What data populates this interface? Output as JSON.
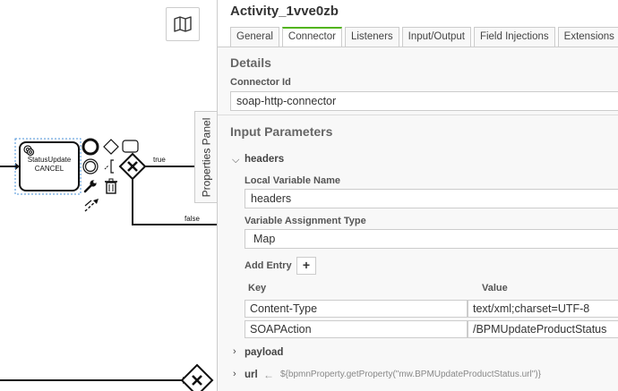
{
  "canvas": {
    "map_button_icon": "map-icon",
    "task_label_line1": "StatusUpdate",
    "task_label_line2": "CANCEL",
    "flow_label_true": "true",
    "flow_label_false": "false",
    "panel_toggle_label": "Properties Panel"
  },
  "panel": {
    "title": "Activity_1vve0zb",
    "tabs": [
      {
        "label": "General"
      },
      {
        "label": "Connector"
      },
      {
        "label": "Listeners"
      },
      {
        "label": "Input/Output"
      },
      {
        "label": "Field Injections"
      },
      {
        "label": "Extensions"
      }
    ],
    "active_tab": "Connector",
    "details": {
      "title": "Details",
      "connector_id_label": "Connector Id",
      "connector_id_value": "soap-http-connector"
    },
    "input_parameters": {
      "title": "Input Parameters",
      "headers": {
        "name": "headers",
        "local_variable_label": "Local Variable Name",
        "local_variable_value": "headers",
        "assignment_type_label": "Variable Assignment Type",
        "assignment_type_value": "Map",
        "add_entry_label": "Add Entry",
        "add_entry_button": "+",
        "columns": {
          "key": "Key",
          "value": "Value"
        },
        "entries": [
          {
            "key": "Content-Type",
            "value": "text/xml;charset=UTF-8"
          },
          {
            "key": "SOAPAction",
            "value": "/BPMUpdateProductStatus"
          }
        ]
      },
      "payload": {
        "name": "payload"
      },
      "url": {
        "name": "url",
        "expression": "${bpmnProperty.getProperty(\"mw.BPMUpdateProductStatus.url\")}"
      }
    }
  },
  "colors": {
    "active_tab_accent": "#52b415",
    "selection_outline": "#4a90d9"
  }
}
